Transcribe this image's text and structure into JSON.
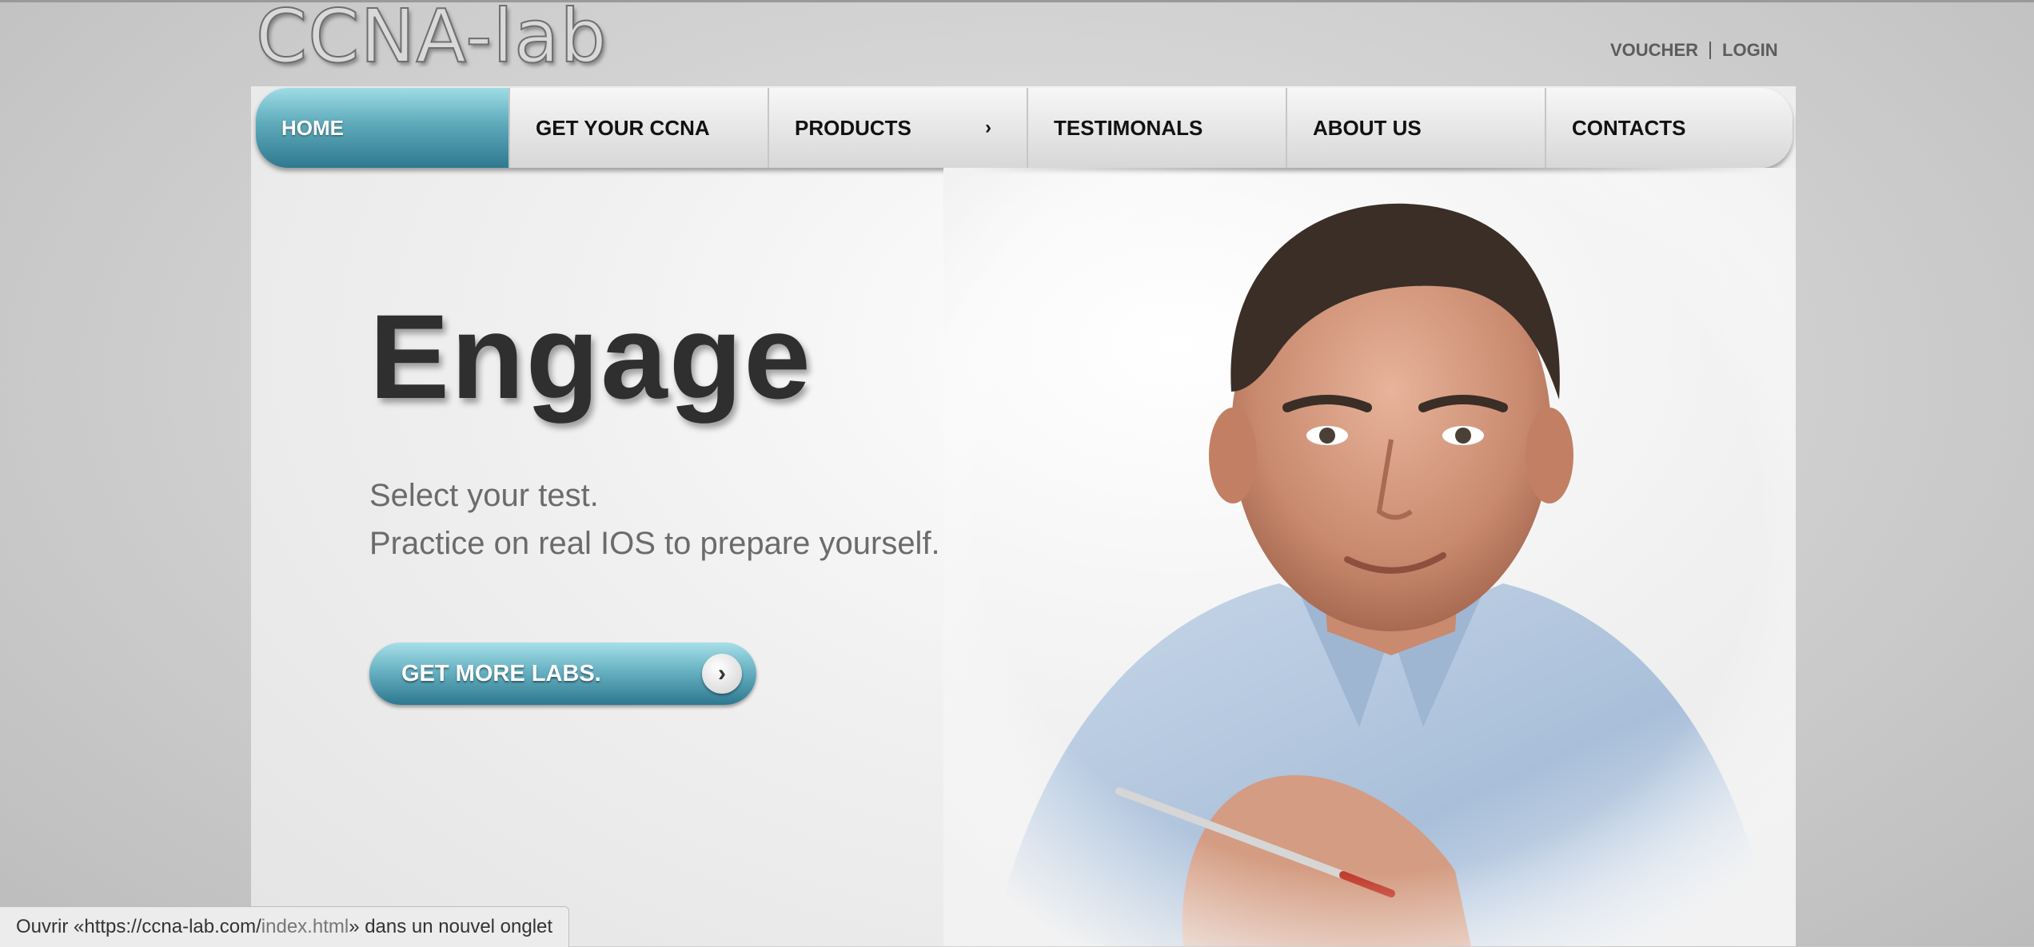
{
  "header": {
    "logo_text": "CCNA-lab",
    "links": [
      "VOUCHER",
      "LOGIN"
    ]
  },
  "nav": {
    "items": [
      {
        "label": "HOME",
        "active": true
      },
      {
        "label": "GET YOUR CCNA",
        "active": false
      },
      {
        "label": "PRODUCTS",
        "active": false,
        "has_submenu": true
      },
      {
        "label": "TESTIMONALS",
        "active": false
      },
      {
        "label": "ABOUT US",
        "active": false
      },
      {
        "label": "CONTACTS",
        "active": false
      }
    ],
    "submenu_indicator": "›"
  },
  "hero": {
    "title": "Engage",
    "line1": "Select your test.",
    "line2": "Practice on real IOS to prepare yourself.",
    "cta_label": "GET MORE LABS.",
    "cta_icon": "chevron-right-icon",
    "cta_glyph": "›"
  },
  "status_bar": {
    "prefix": "Ouvrir « ",
    "url_host": "https://ccna-lab.com/",
    "url_path": "index.html",
    "suffix": " » dans un nouvel onglet"
  },
  "colors": {
    "accent_teal": "#2f7990",
    "accent_light": "#9fdce6",
    "text_dark": "#2f2f2f"
  }
}
